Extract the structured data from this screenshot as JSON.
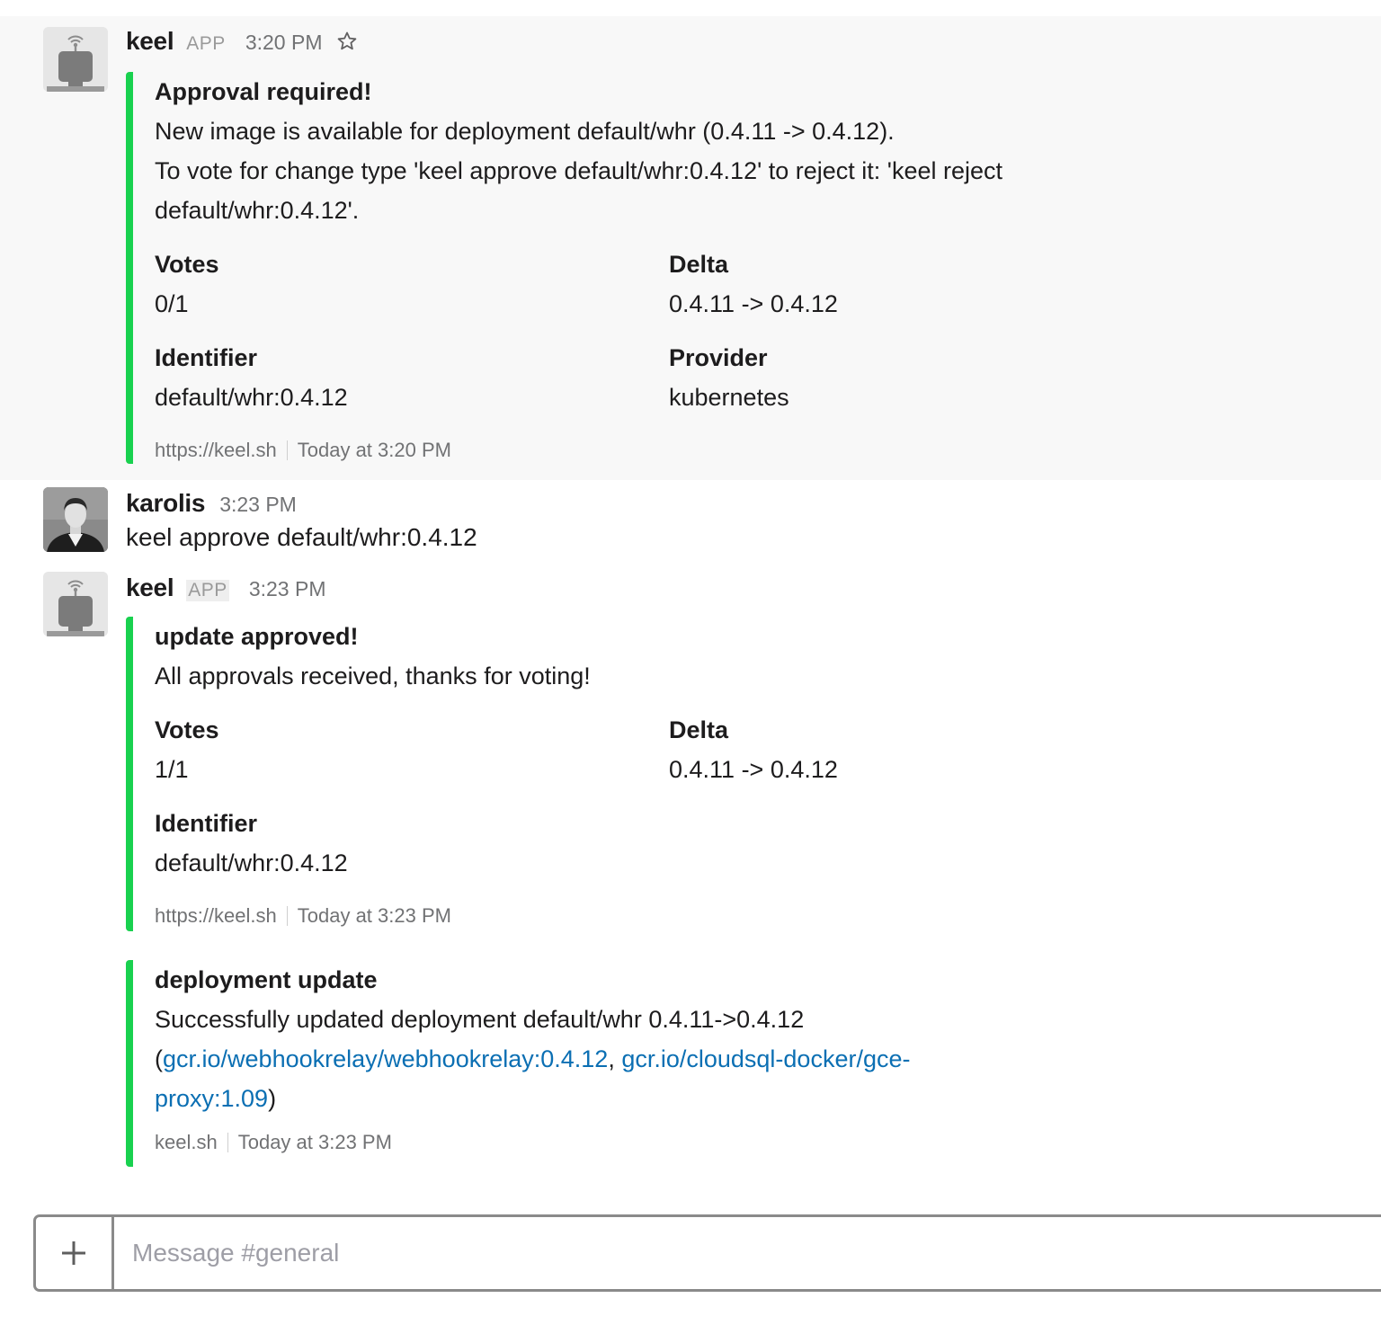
{
  "channel": {
    "placeholder": "Message #general"
  },
  "messages": [
    {
      "username": "keel",
      "badge": "APP",
      "time": "3:20 PM",
      "attachment": {
        "title": "Approval required!",
        "text_lines": [
          "New image is available for deployment default/whr (0.4.11 -> 0.4.12).",
          "To vote for change type 'keel approve default/whr:0.4.12' to reject it: 'keel reject",
          "default/whr:0.4.12'."
        ],
        "fields": [
          {
            "label": "Votes",
            "value": "0/1"
          },
          {
            "label": "Delta",
            "value": "0.4.11 -> 0.4.12"
          },
          {
            "label": "Identifier",
            "value": "default/whr:0.4.12"
          },
          {
            "label": "Provider",
            "value": "kubernetes"
          }
        ],
        "footer": "https://keel.sh",
        "footer_time": "Today at 3:20 PM"
      }
    },
    {
      "username": "karolis",
      "time": "3:23 PM",
      "text": "keel approve default/whr:0.4.12"
    },
    {
      "username": "keel",
      "badge": "APP",
      "time": "3:23 PM",
      "attachment": {
        "title": "update approved!",
        "text_lines": [
          "All approvals received, thanks for voting!"
        ],
        "fields": [
          {
            "label": "Votes",
            "value": "1/1"
          },
          {
            "label": "Delta",
            "value": "0.4.11 -> 0.4.12"
          },
          {
            "label": "Identifier",
            "value": "default/whr:0.4.12"
          }
        ],
        "footer": "https://keel.sh",
        "footer_time": "Today at 3:23 PM"
      },
      "attachment2": {
        "title": "deployment update",
        "line1": "Successfully updated deployment default/whr 0.4.11->0.4.12",
        "open_paren": "(",
        "link1": "gcr.io/webhookrelay/webhookrelay:0.4.12",
        "comma": ", ",
        "link2_part1": "gcr.io/cloudsql-docker/gce-",
        "link2_part2": "proxy:1.09",
        "close_paren": ")",
        "footer": "keel.sh",
        "footer_time": "Today at 3:23 PM"
      }
    }
  ]
}
